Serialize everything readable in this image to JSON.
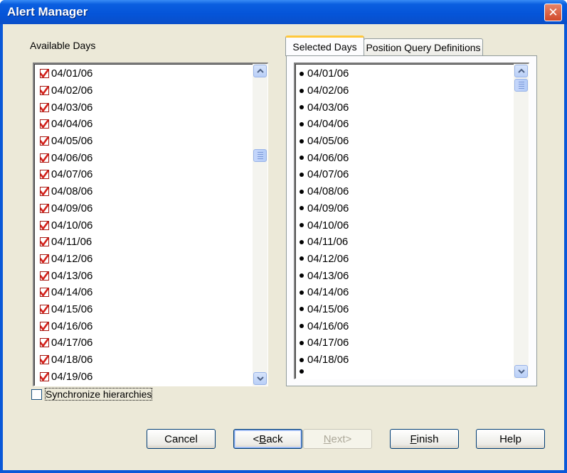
{
  "window": {
    "title": "Alert Manager"
  },
  "available": {
    "label": "Available Days",
    "items": [
      "04/01/06",
      "04/02/06",
      "04/03/06",
      "04/04/06",
      "04/05/06",
      "04/06/06",
      "04/07/06",
      "04/08/06",
      "04/09/06",
      "04/10/06",
      "04/11/06",
      "04/12/06",
      "04/13/06",
      "04/14/06",
      "04/15/06",
      "04/16/06",
      "04/17/06",
      "04/18/06",
      "04/19/06"
    ]
  },
  "tabs": [
    {
      "label": "Selected Days",
      "active": true
    },
    {
      "label": "Position Query Definitions",
      "active": false
    }
  ],
  "selected": {
    "items": [
      "04/01/06",
      "04/02/06",
      "04/03/06",
      "04/04/06",
      "04/05/06",
      "04/06/06",
      "04/07/06",
      "04/08/06",
      "04/09/06",
      "04/10/06",
      "04/11/06",
      "04/12/06",
      "04/13/06",
      "04/14/06",
      "04/15/06",
      "04/16/06",
      "04/17/06",
      "04/18/06"
    ]
  },
  "sync": {
    "label": "Synchronize hierarchies",
    "checked": false
  },
  "buttons": {
    "cancel": "Cancel",
    "back_pre": "<",
    "back_u": "B",
    "back_post": "ack",
    "next_u": "N",
    "next_post": "ext>",
    "finish_u": "F",
    "finish_post": "inish",
    "help": "Help"
  },
  "colors": {
    "check": "#d3201a",
    "titlebar": "#0554d8",
    "face": "#ece9d8"
  },
  "icons": {
    "check": "red-checkmark-icon",
    "bullet": "bullet-icon",
    "close": "close-icon"
  }
}
